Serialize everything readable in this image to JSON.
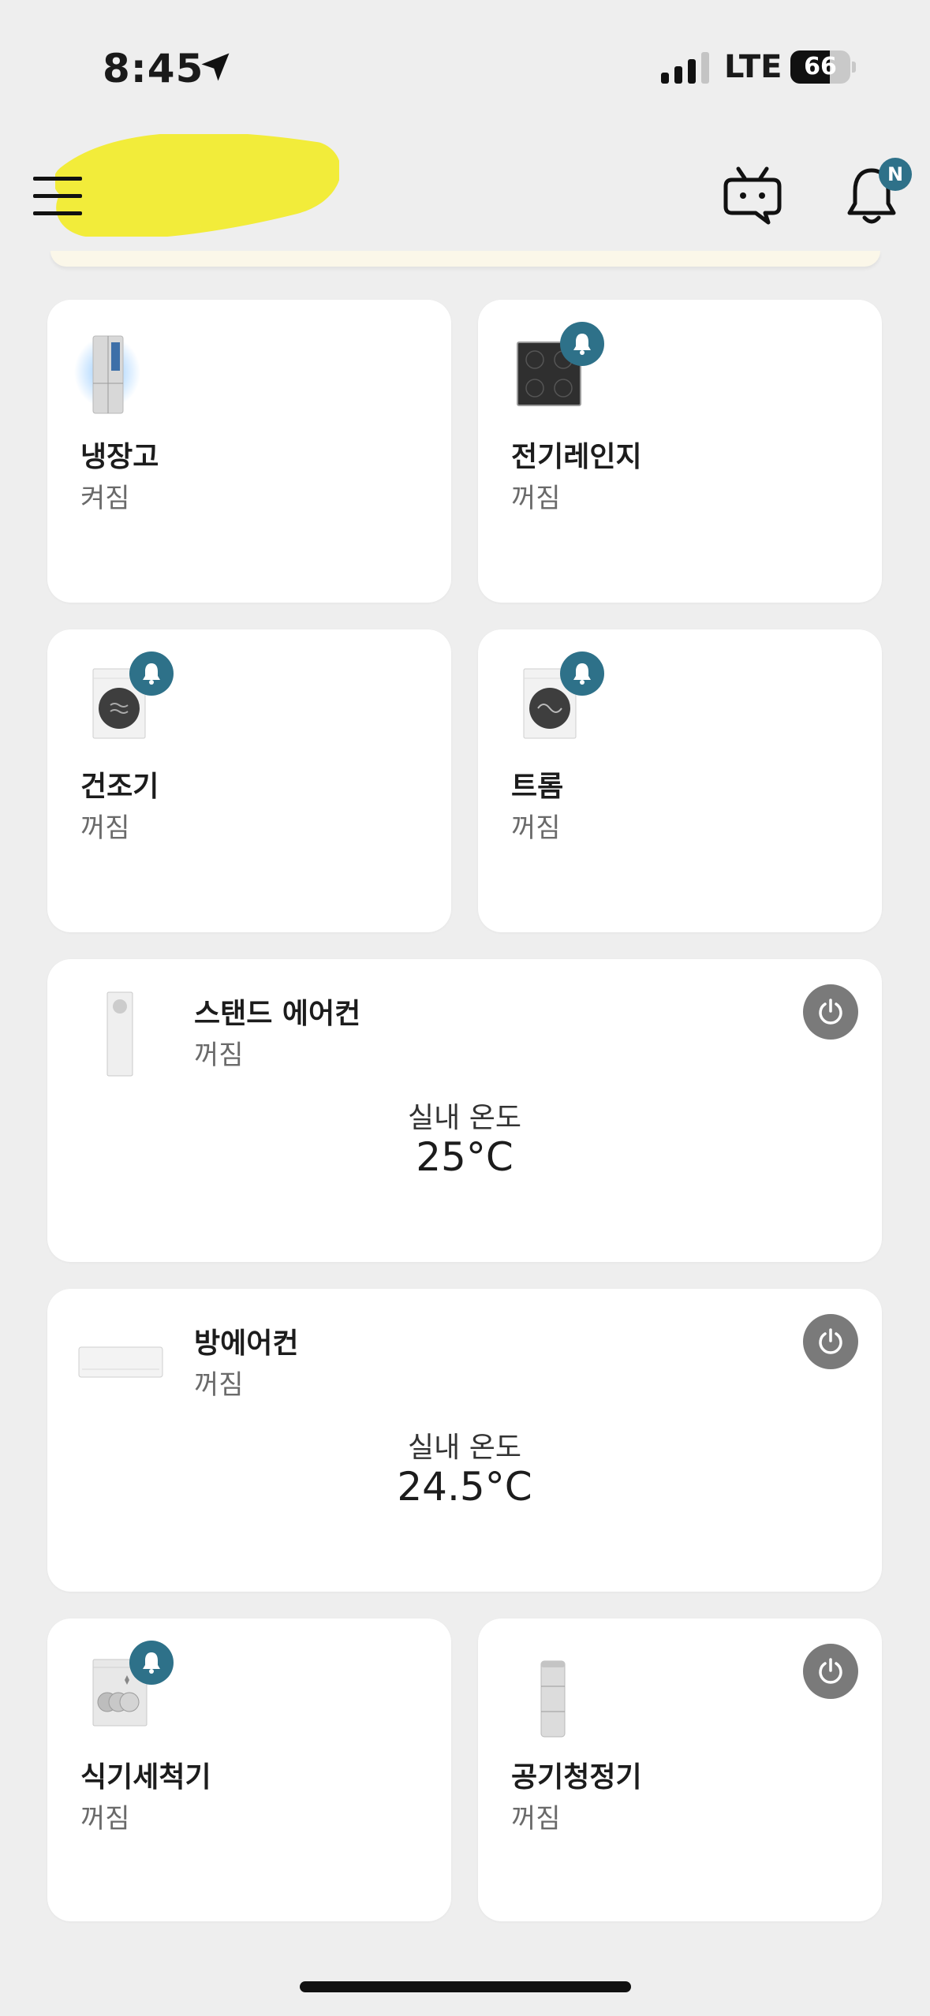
{
  "status_bar": {
    "time": "8:45",
    "network": "LTE",
    "battery_level": 66,
    "battery_text": "66"
  },
  "header": {
    "menu_icon": "hamburger-menu-icon",
    "bot_icon": "chatbot-icon",
    "bell_icon": "bell-icon",
    "notification_badge": "N"
  },
  "colors": {
    "accent": "#2e7189",
    "power_button": "#7a7a7a",
    "background": "#eeeeee",
    "card": "#ffffff",
    "redaction": "#f2ec3a"
  },
  "devices": [
    {
      "name": "냉장고",
      "status": "켜짐",
      "icon": "refrigerator-icon",
      "has_alert": false,
      "has_power": false
    },
    {
      "name": "전기레인지",
      "status": "꺼짐",
      "icon": "electric-range-icon",
      "has_alert": true,
      "has_power": false
    },
    {
      "name": "건조기",
      "status": "꺼짐",
      "icon": "dryer-icon",
      "has_alert": true,
      "has_power": false
    },
    {
      "name": "트롬",
      "status": "꺼짐",
      "icon": "washer-icon",
      "has_alert": true,
      "has_power": false
    },
    {
      "name": "스탠드 에어컨",
      "status": "꺼짐",
      "icon": "standing-air-conditioner-icon",
      "has_power": true,
      "temp_label": "실내 온도",
      "temp_value": "25°C"
    },
    {
      "name": "방에어컨",
      "status": "꺼짐",
      "icon": "wall-air-conditioner-icon",
      "has_power": true,
      "temp_label": "실내 온도",
      "temp_value": "24.5°C"
    },
    {
      "name": "식기세척기",
      "status": "꺼짐",
      "icon": "dishwasher-icon",
      "has_alert": true,
      "has_power": false
    },
    {
      "name": "공기청정기",
      "status": "꺼짐",
      "icon": "air-purifier-icon",
      "has_alert": false,
      "has_power": true
    }
  ]
}
